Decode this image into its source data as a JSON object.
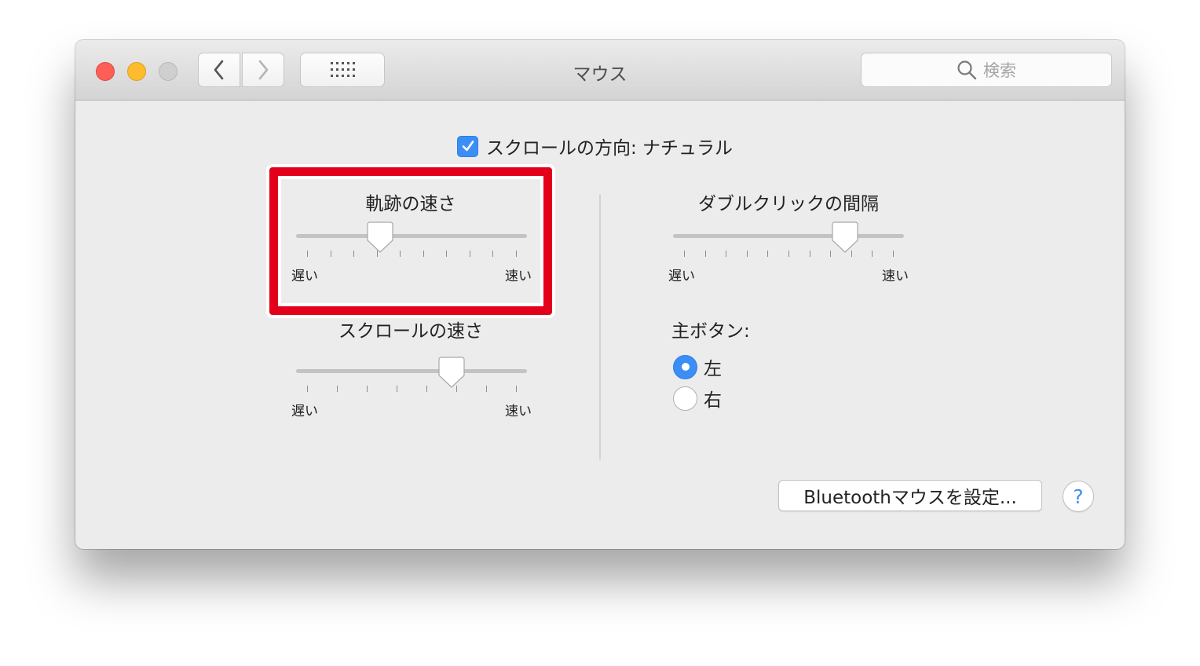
{
  "window": {
    "title": "マウス",
    "search_placeholder": "検索"
  },
  "scroll_direction": {
    "label": "スクロールの方向: ナチュラル",
    "checked": true
  },
  "tracking_speed": {
    "title": "軌跡の速さ",
    "min_label": "遅い",
    "max_label": "速い",
    "tick_count": 10,
    "value_fraction": 0.35
  },
  "scroll_speed": {
    "title": "スクロールの速さ",
    "min_label": "遅い",
    "max_label": "速い",
    "tick_count": 8,
    "value_fraction": 0.69
  },
  "double_click": {
    "title": "ダブルクリックの間隔",
    "min_label": "遅い",
    "max_label": "速い",
    "tick_count": 11,
    "value_fraction": 0.77
  },
  "primary_button": {
    "title": "主ボタン:",
    "options": [
      {
        "label": "左",
        "selected": true
      },
      {
        "label": "右",
        "selected": false
      }
    ]
  },
  "bluetooth_button": "Bluetoothマウスを設定...",
  "help_button": "?",
  "colors": {
    "accent": "#3b8ef5",
    "highlight": "#e3001b"
  }
}
